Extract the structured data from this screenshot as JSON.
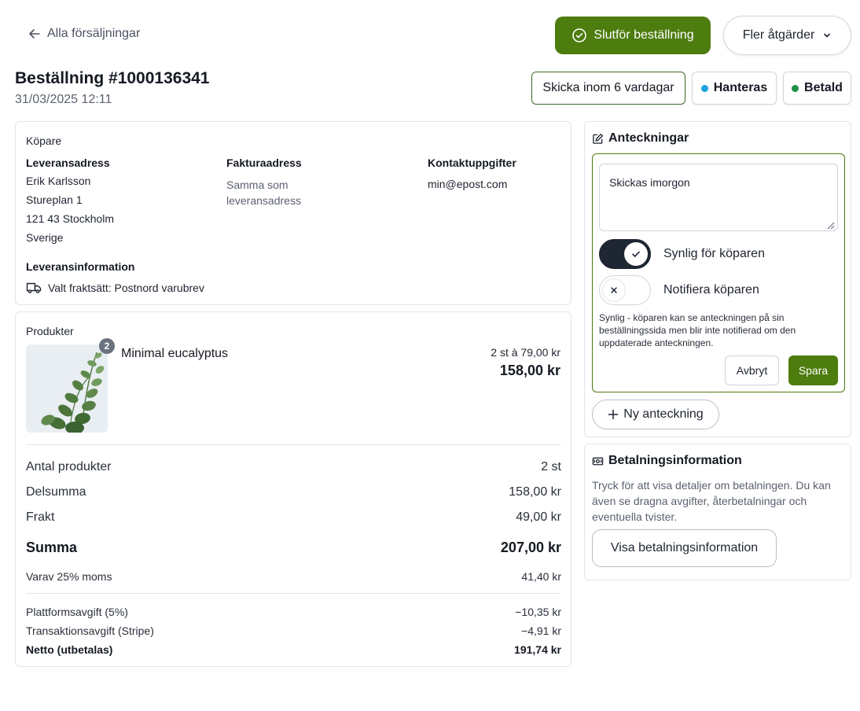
{
  "header": {
    "back_label": "Alla försäljningar",
    "complete_label": "Slutför beställning",
    "more_label": "Fler åtgärder",
    "order_title": "Beställning #1000136341",
    "order_date": "31/03/2025 12:11",
    "ship_badge": "Skicka inom 6 vardagar",
    "status_badge": "Hanteras",
    "payment_badge": "Betald",
    "status_color": "#1ea2e0",
    "payment_color": "#1f8f4a"
  },
  "buyer": {
    "section_label": "Köpare",
    "delivery_head": "Leveransadress",
    "delivery_lines": [
      "Erik Karlsson",
      "Stureplan 1",
      "121 43 Stockholm",
      "Sverige"
    ],
    "billing_head": "Fakturaadress",
    "billing_text": "Samma som leveransadress",
    "contact_head": "Kontaktuppgifter",
    "contact_email": "min@epost.com",
    "shipping_head": "Leveransinformation",
    "shipping_method": "Valt fraktsätt: Postnord varubrev"
  },
  "products": {
    "section_label": "Produkter",
    "items": [
      {
        "name": "Minimal eucalyptus",
        "quantity": "2",
        "unit_price": "2 st à 79,00 kr",
        "line_total": "158,00 kr"
      }
    ],
    "summary": {
      "count_label": "Antal produkter",
      "count_value": "2 st",
      "subtotal_label": "Delsumma",
      "subtotal_value": "158,00 kr",
      "shipping_label": "Frakt",
      "shipping_value": "49,00 kr",
      "total_label": "Summa",
      "total_value": "207,00 kr",
      "vat_label": "Varav 25% moms",
      "vat_value": "41,40 kr",
      "platform_fee_label": "Plattformsavgift (5%)",
      "platform_fee_value": "−10,35 kr",
      "transaction_fee_label": "Transaktionsavgift (Stripe)",
      "transaction_fee_value": "−4,91 kr",
      "net_label": "Netto (utbetalas)",
      "net_value": "191,74 kr"
    }
  },
  "notes": {
    "title": "Anteckningar",
    "note_text": "Skickas imorgon",
    "visible_label": "Synlig för köparen",
    "visible_on": true,
    "notify_label": "Notifiera köparen",
    "notify_on": false,
    "help_text": "Synlig - köparen kan se anteckningen på sin beställningssida men blir inte notifierad om den uppdaterade anteckningen.",
    "cancel_label": "Avbryt",
    "save_label": "Spara",
    "new_note_label": "Ny anteckning"
  },
  "payment": {
    "title": "Betalningsinformation",
    "description": "Tryck för att visa detaljer om betalningen. Du kan även se dragna avgifter, återbetalningar och eventuella tvister.",
    "button_label": "Visa betalningsinformation"
  },
  "colors": {
    "accent": "#4d7c0f",
    "dark": "#1e2533"
  }
}
